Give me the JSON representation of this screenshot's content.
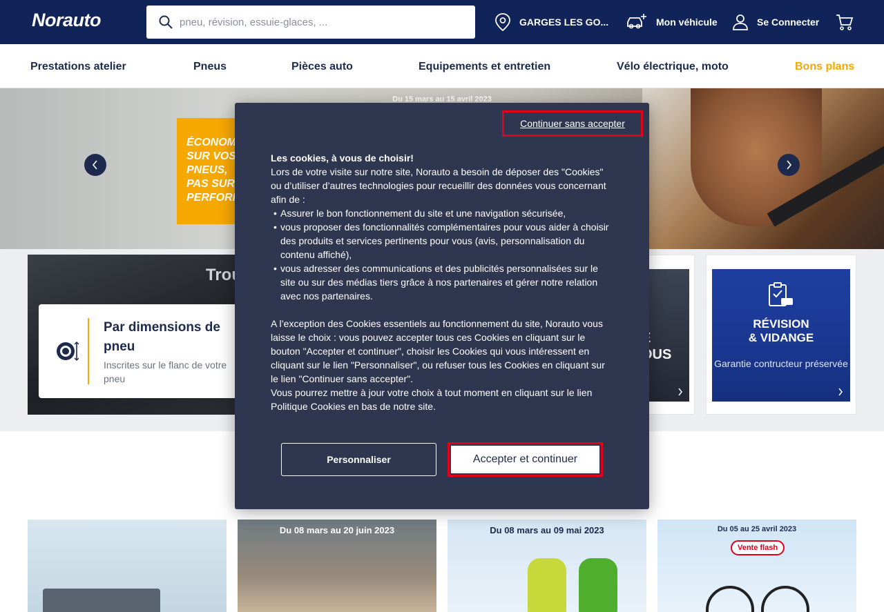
{
  "header": {
    "logo_main": "Norauto",
    "search_placeholder": "pneu, révision, essuie-glaces, ...",
    "store": "GARGES LES GO...",
    "vehicle": "Mon véhicule",
    "login": "Se Connecter"
  },
  "nav": {
    "items": [
      "Prestations atelier",
      "Pneus",
      "Pièces auto",
      "Equipements et entretien",
      "Vélo électrique, moto",
      "Bons plans"
    ]
  },
  "hero": {
    "dates": "Du 15 mars au 15 avril 2023",
    "promo_lines": [
      "ÉCONOM",
      "SUR VOS",
      "PNEUS,",
      "PAS SUR",
      "PERFORM"
    ]
  },
  "find": {
    "title": "Trou",
    "dim_title": "Par dimensions de pneu",
    "dim_sub": "Inscrites sur le flanc de votre pneu",
    "card3_lines": [
      "E",
      "OUS"
    ],
    "card4_title_1": "RÉVISION",
    "card4_title_2": "& VIDANGE",
    "card4_sub": "Garantie contructeur préservée"
  },
  "products": {
    "p2_date": "Du 08 mars au 20 juin 2023",
    "p3_date": "Du 08 mars au 09 mai 2023",
    "p4_date": "Du 05 au 25 avril 2023",
    "p4_badge": "Vente flash"
  },
  "cookie_modal": {
    "skip": "Continuer sans accepter",
    "heading": "Les cookies, à vous de choisir!",
    "intro": "Lors de votre visite sur notre site, Norauto a besoin de déposer des \"Cookies\" ou d’utiliser d’autres technologies pour recueillir des données vous concernant afin de :",
    "bullets": [
      "Assurer le bon fonctionnement du site et une navigation sécurisée,",
      "vous proposer des fonctionnalités complémentaires pour vous aider à choisir des produits et services pertinents pour vous (avis, personnalisation du contenu affiché),",
      "vous adresser des communications et des publicités personnalisées sur le site ou sur des médias tiers grâce à nos partenaires et gérer notre relation avec nos partenaires."
    ],
    "para2": "A l’exception des Cookies essentiels au fonctionnement du site, Norauto vous laisse le choix : vous pouvez accepter tous ces Cookies en cliquant sur le bouton \"Accepter et continuer\", choisir les Cookies qui vous intéressent en cliquant sur le lien \"Personnaliser\", ou refuser tous les Cookies en cliquant sur le lien \"Continuer sans accepter\".",
    "para3": "Vous pourrez mettre à jour votre choix à tout moment en cliquant sur le lien Politique Cookies en bas de notre site.",
    "btn_customize": "Personnaliser",
    "btn_accept": "Accepter et continuer"
  },
  "colors": {
    "brand_navy": "#10245a",
    "accent_orange": "#f6a800",
    "modal_bg": "#2f3750",
    "highlight_red": "#e2001a"
  }
}
